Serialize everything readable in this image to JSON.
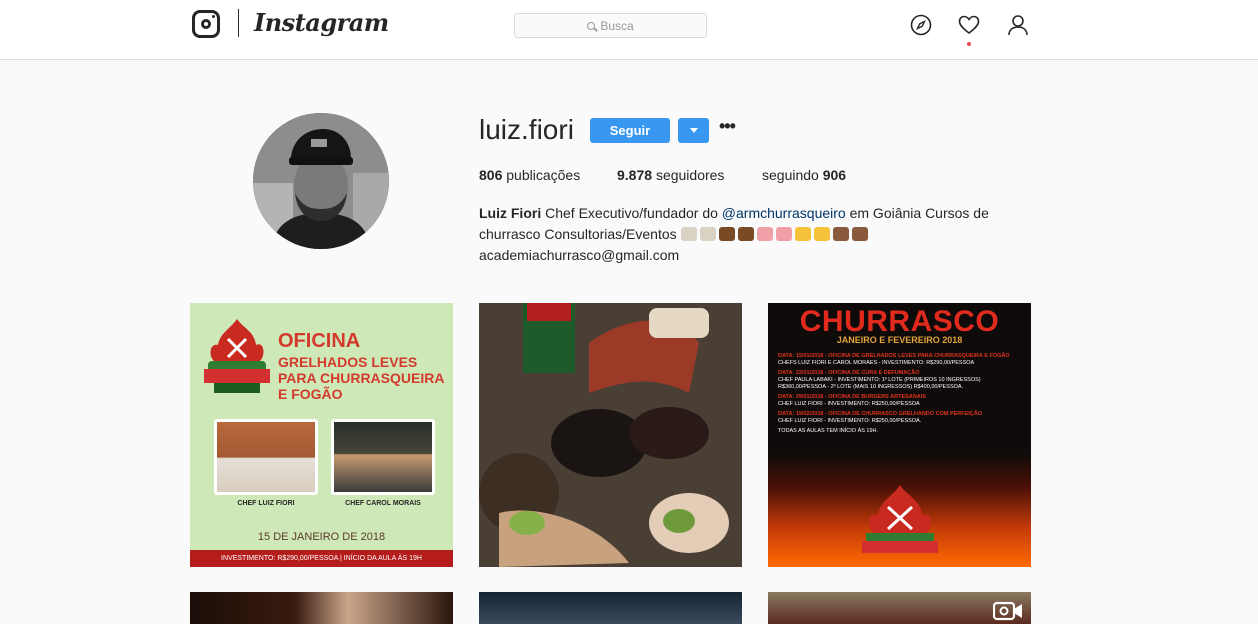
{
  "app": {
    "wordmark": "Instagram"
  },
  "search": {
    "placeholder": "Busca"
  },
  "nav": {
    "icons": [
      "explore-icon",
      "activity-heart-icon",
      "profile-icon"
    ]
  },
  "profile": {
    "username": "luiz.fiori",
    "follow_label": "Seguir",
    "more_label": "•••",
    "stats": {
      "posts_count": "806",
      "posts_label": "publicações",
      "followers_count": "9.878",
      "followers_label": "seguidores",
      "following_label": "seguindo",
      "following_count": "906"
    },
    "bio": {
      "full_name": "Luiz Fiori",
      "text_before": "Chef Executivo/fundador do",
      "mention": "@armchurrasqueiro",
      "text_after": "em Goiânia Cursos de churrasco Consultorias/Eventos",
      "email": "academiachurrasco@gmail.com"
    }
  },
  "posts": {
    "post1": {
      "title": "OFICINA",
      "subtitle": "Grelhados leves para churrasqueira e fogão",
      "chef_a": "CHEF LUIZ FIORI",
      "chef_b": "CHEF CAROL MORAIS",
      "date": "15 DE JANEIRO DE 2018",
      "footer": "INVESTIMENTO: R$290,00/PESSOA | INÍCIO DA AULA ÀS 19H"
    },
    "post3": {
      "title": "CHURRASCO",
      "subtitle": "JANEIRO E FEVEREIRO 2018",
      "items": [
        {
          "head": "DATA: 15/01/2018 - OFICINA DE GRELHADOS LEVES PARA CHURRASQUEIRA E FOGÃO",
          "body": "CHEFS LUIZ FIORI E CAROL MORAES - INVESTIMENTO: R$290,00/PESSOA"
        },
        {
          "head": "DATA: 22/01/2018 - OFICINA DE CURA E DEFUMAÇÃO",
          "body": "CHEF PAULA LABAKI - INVESTIMENTO: 1º LOTE (PRIMEIROS 10 INGRESSOS) R$360,00/PESSOA - 2º LOTE (MAIS 10 INGRESSOS) R$400,00/PESSOA."
        },
        {
          "head": "DATA: 29/01/2018 - OFICINA DE BURGERS ARTESANAIS",
          "body": "CHEF LUIZ FIORI - INVESTIMENTO: R$250,00/PESSOA"
        },
        {
          "head": "DATA: 19/02/2018 - OFICINA DE CHURRASCO GRELHANDO COM PERFEIÇÃO",
          "body": "CHEF LUIZ FIORI - INVESTIMENTO: R$250,00/PESSOA."
        }
      ],
      "note": "TODAS AS AULAS TEM INÍCIO ÀS 19H."
    }
  },
  "colors": {
    "accent": "#3897f0",
    "text": "#262626",
    "mention": "#003569",
    "notification": "#ed4956"
  }
}
